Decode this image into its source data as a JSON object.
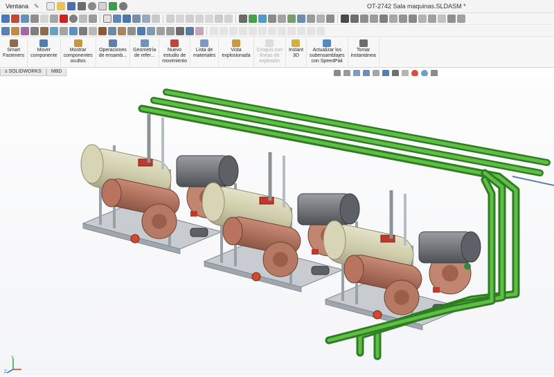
{
  "titlebar": {
    "menu": "Ventana",
    "document_title": "OT-2742 Sala maquinas.SLDASM *"
  },
  "command_manager": {
    "items": [
      {
        "label": "Smart\nFasteners",
        "enabled": true
      },
      {
        "label": "Mover\ncomponente",
        "enabled": true
      },
      {
        "label": "Mostrar\ncomponentes\nocultos",
        "enabled": true
      },
      {
        "label": "Operaciones\nde ensamb...",
        "enabled": true
      },
      {
        "label": "Geometría\nde refer...",
        "enabled": true
      },
      {
        "label": "Nuevo\nestudio de\nmovimiento",
        "enabled": true
      },
      {
        "label": "Lista de\nmateriales",
        "enabled": true
      },
      {
        "label": "Vista\nexplosionada",
        "enabled": true
      },
      {
        "label": "Croquis con\nlíneas de\nexplosión",
        "enabled": false
      },
      {
        "label": "Instant\n3D",
        "enabled": true
      },
      {
        "label": "Actualizar los\nsubensamblajes\ncon SpeedPak",
        "enabled": true
      },
      {
        "label": "Tomar\ninstantánea",
        "enabled": true
      }
    ]
  },
  "tabs": [
    {
      "label": "s SOLIDWORKS"
    },
    {
      "label": "MBD"
    }
  ],
  "colors": {
    "pipe_green": "#3f9b2c",
    "frame_gray": "#a8adb3",
    "tank_cream": "#d9d6b5",
    "compressor_copper": "#b0705a",
    "motor_gray": "#6b6e73",
    "valve_red": "#c0392b",
    "pipe_blue": "#5b7fa8"
  }
}
